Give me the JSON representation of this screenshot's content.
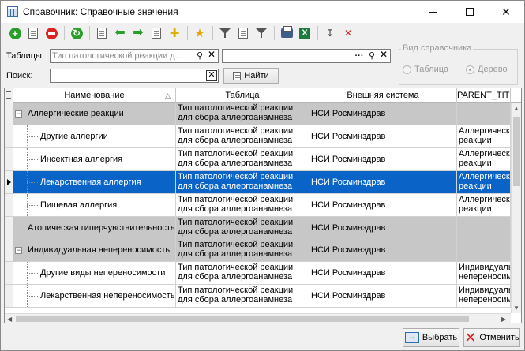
{
  "window": {
    "title": "Справочник: Справочные значения"
  },
  "filters": {
    "tables_label": "Таблицы:",
    "tables_value": "Тип патологической реакции д...",
    "search2_value": "",
    "search_label": "Поиск:",
    "search_value": "",
    "find_button": "Найти"
  },
  "view_group": {
    "legend": "Вид справочника",
    "options": [
      "Таблица",
      "Дерево"
    ],
    "selected": "Дерево"
  },
  "grid": {
    "columns": [
      "Наименование",
      "Таблица",
      "Внешняя система",
      "PARENT_TITLE"
    ],
    "rows": [
      {
        "name": "Аллергические реакции",
        "table": "Тип патологической реакции для сбора аллергоанамнеза",
        "ext": "НСИ Росминздрав",
        "parent": ""
      },
      {
        "name": "Другие аллергии",
        "table": "Тип патологической реакции для сбора аллергоанамнеза",
        "ext": "НСИ Росминздрав",
        "parent": "Аллергические реакции"
      },
      {
        "name": "Инсектная аллергия",
        "table": "Тип патологической реакции для сбора аллергоанамнеза",
        "ext": "НСИ Росминздрав",
        "parent": "Аллергические реакции"
      },
      {
        "name": "Лекарственная аллергия",
        "table": "Тип патологической реакции для сбора аллергоанамнеза",
        "ext": "НСИ Росминздрав",
        "parent": "Аллергические реакции"
      },
      {
        "name": "Пищевая аллергия",
        "table": "Тип патологической реакции для сбора аллергоанамнеза",
        "ext": "НСИ Росминздрав",
        "parent": "Аллергические реакции"
      },
      {
        "name": "Атопическая гиперчувствительность",
        "table": "Тип патологической реакции для сбора аллергоанамнеза",
        "ext": "НСИ Росминздрав",
        "parent": ""
      },
      {
        "name": "Индивидуальная непереносимость",
        "table": "Тип патологической реакции для сбора аллергоанамнеза",
        "ext": "НСИ Росминздрав",
        "parent": ""
      },
      {
        "name": "Другие виды непереносимости",
        "table": "Тип патологической реакции для сбора аллергоанамнеза",
        "ext": "НСИ Росминздрав",
        "parent": "Индивидуальная непереносимость"
      },
      {
        "name": "Лекарственная непереносимость",
        "table": "Тип патологической реакции для сбора аллергоанамнеза",
        "ext": "НСИ Росминздрав",
        "parent": "Индивидуальная непереносимость"
      }
    ]
  },
  "footer": {
    "select_button": "Выбрать",
    "cancel_button": "Отменить"
  },
  "colors": {
    "selection": "#0a64c8",
    "group_row": "#c7c7c7"
  }
}
